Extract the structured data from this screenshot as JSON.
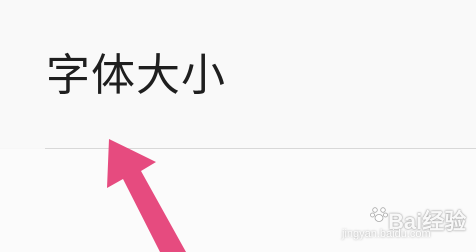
{
  "settings": {
    "font_size_label": "字体大小"
  },
  "watermark": {
    "brand": "Bai经验",
    "site": "jingyan.baidu.com"
  },
  "colors": {
    "arrow": "#e64b7f",
    "text": "#1f1f1f",
    "divider": "#d8d8d8",
    "background": "#f7f7f7"
  },
  "icons": {
    "pointer": "pink-arrow-icon",
    "watermark": "baidu-paw-icon"
  }
}
